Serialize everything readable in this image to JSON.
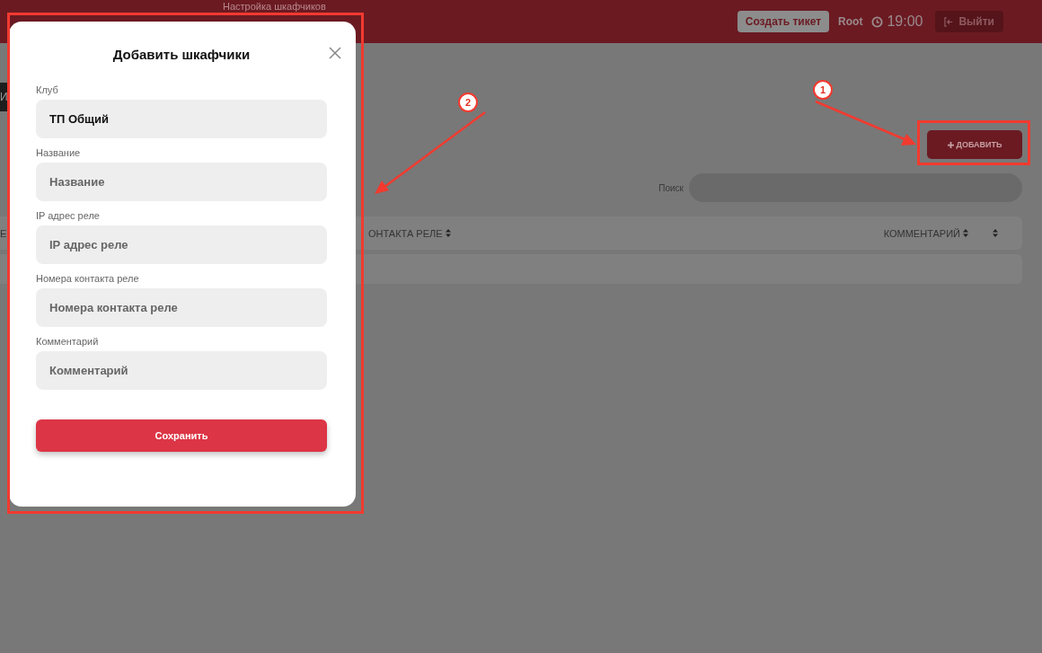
{
  "header": {
    "title": "Настройка шкафчиков",
    "create_ticket": "Создать тикет",
    "user": "Root",
    "time": "19:00",
    "logout": "Выйти"
  },
  "side_tab": {
    "label": "И"
  },
  "toolbar": {
    "add_button": "ДОБАВИТЬ"
  },
  "search": {
    "label": "Поиск"
  },
  "table": {
    "columns": [
      {
        "label": "Е"
      },
      {
        "label": "ОНТАКТА РЕЛЕ"
      },
      {
        "label": "КОММЕНТАРИЙ"
      }
    ]
  },
  "modal": {
    "title": "Добавить шкафчики",
    "fields": [
      {
        "label": "Клуб",
        "value": "ТП Общий"
      },
      {
        "label": "Название",
        "placeholder": "Название"
      },
      {
        "label": "IP адрес реле",
        "placeholder": "IP адрес реле"
      },
      {
        "label": "Номера контакта реле",
        "placeholder": "Номера контакта реле"
      },
      {
        "label": "Комментарий",
        "placeholder": "Комментарий"
      }
    ],
    "save_button": "Сохранить"
  },
  "annotations": [
    {
      "number": "1"
    },
    {
      "number": "2"
    }
  ]
}
